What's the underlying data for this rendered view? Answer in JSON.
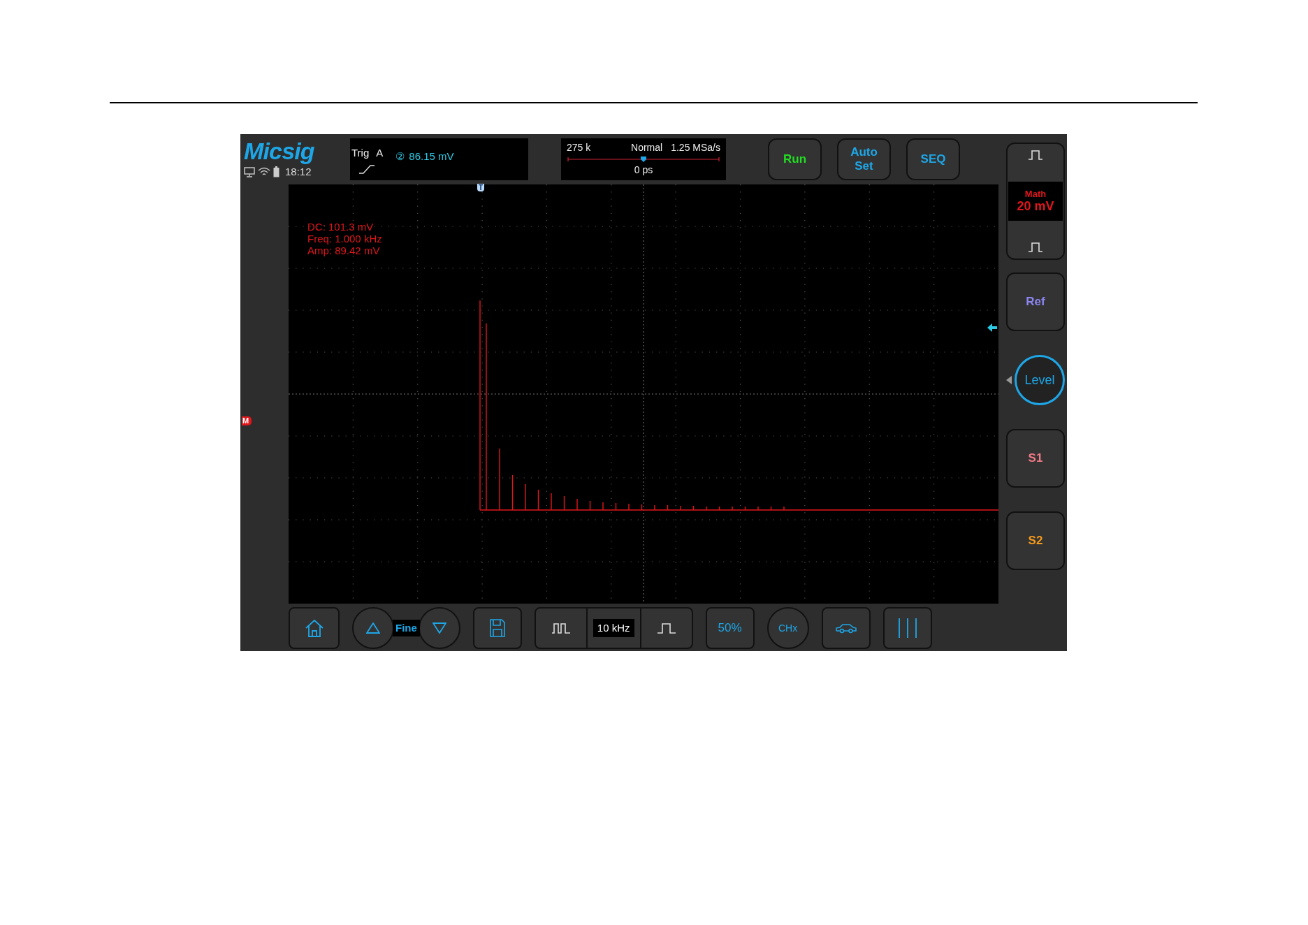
{
  "logo": "Micsig",
  "status": {
    "time": "18:12"
  },
  "trigger": {
    "label": "Trig",
    "source": "A",
    "channel": "②",
    "value": "86.15 mV"
  },
  "timebase": {
    "memory": "275 k",
    "mode": "Normal",
    "sample_rate": "1.25 MSa/s",
    "offset": "0 ps"
  },
  "top_buttons": [
    {
      "label": "Run",
      "color": "#22dd22"
    },
    {
      "label": "Auto Set",
      "color": "#1ea7e8"
    },
    {
      "label": "SEQ",
      "color": "#1ea7e8"
    }
  ],
  "measurements": [
    "DC: 101.3 mV",
    "Freq: 1.000 kHz",
    "Amp: 89.42 mV"
  ],
  "markers": {
    "trigger": "T",
    "math": "M"
  },
  "math": {
    "label": "Math",
    "scale": "20 mV"
  },
  "side_buttons": [
    {
      "kind": "button",
      "label": "Ref",
      "color": "#8b86f0"
    },
    {
      "kind": "knob",
      "label": "Level",
      "color": "#1ea7e8"
    },
    {
      "kind": "button",
      "label": "S1",
      "color": "#f07a86"
    },
    {
      "kind": "button",
      "label": "S2",
      "color": "#f59a1a"
    }
  ],
  "bottom": {
    "step": "Fine",
    "frequency": "10 kHz",
    "half": "50%",
    "channel": "CHx"
  }
}
